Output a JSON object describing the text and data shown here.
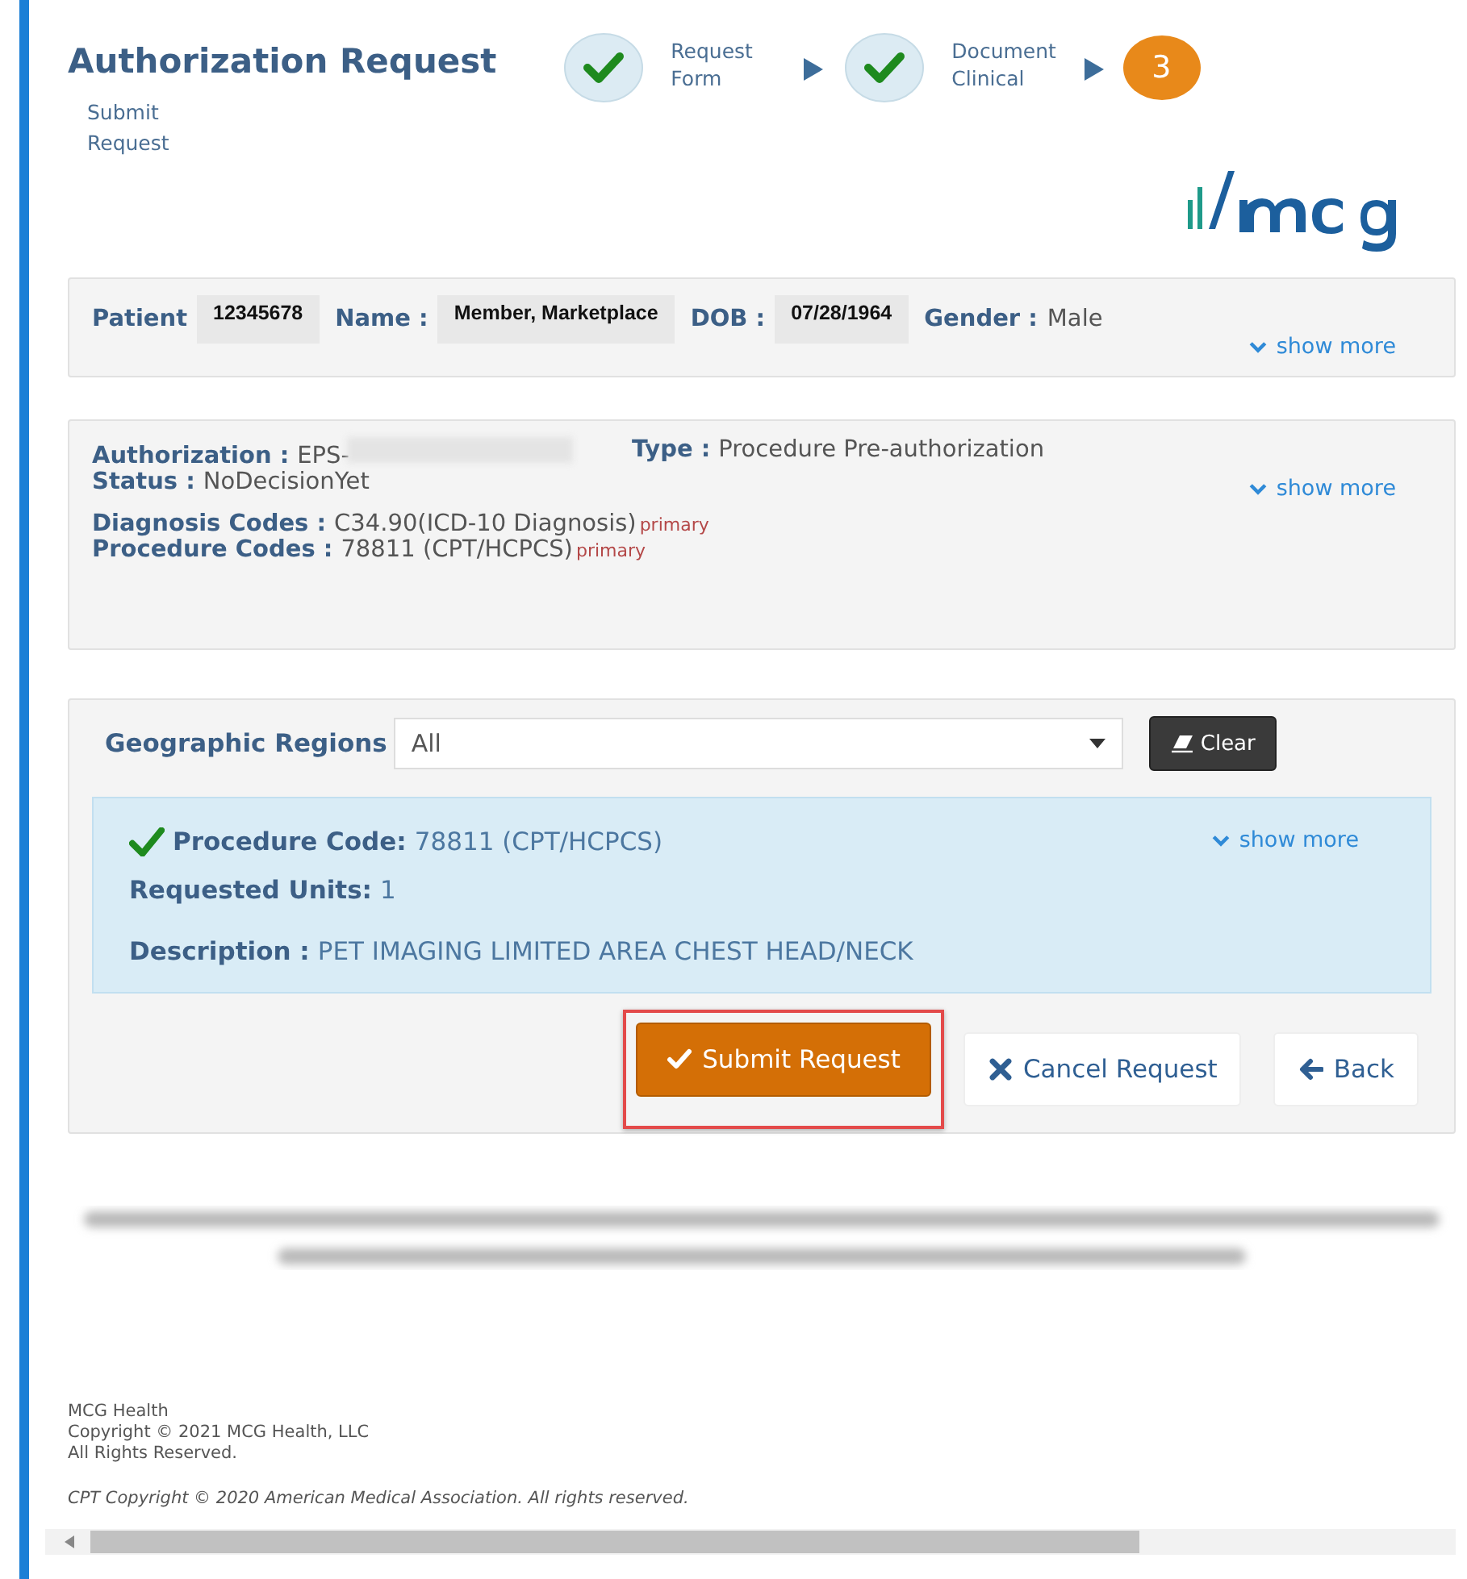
{
  "header": {
    "title": "Authorization Request",
    "current_step_label": "Submit Request",
    "steps": [
      {
        "label": "Request Form",
        "done": true
      },
      {
        "label": "Document Clinical",
        "done": true
      },
      {
        "number": "3",
        "done": false
      }
    ]
  },
  "patient": {
    "fields": [
      {
        "label": "Patient",
        "value": "12345678",
        "masked": true
      },
      {
        "label": "Name :",
        "value": "Member, Marketplace",
        "masked": true
      },
      {
        "label": "DOB :",
        "value": "07/28/1964",
        "masked": true
      },
      {
        "label": "Gender :",
        "value": "Male",
        "masked": false
      }
    ],
    "show_more": "show more"
  },
  "authorization": {
    "id_label": "Authorization :",
    "id_value": "EPS-",
    "id_redacted": true,
    "type_label": "Type :",
    "type_value": "Procedure Pre-authorization",
    "status_label": "Status :",
    "status_value": "NoDecisionYet",
    "show_more": "show more",
    "codes": [
      {
        "label": "Diagnosis Codes :",
        "value": "C34.90(ICD-10 Diagnosis)",
        "tag": "primary"
      },
      {
        "label": "Procedure Codes :",
        "value": "78811 (CPT/HCPCS)",
        "tag": "primary"
      }
    ]
  },
  "regions": {
    "label": "Geographic Regions",
    "value": "All",
    "clear": "Clear",
    "procedure": {
      "approved": true,
      "code_label": "Procedure Code:",
      "code_value": "78811 (CPT/HCPCS)",
      "show_more": "show more",
      "units_label": "Requested Units:",
      "units_value": "1",
      "description_label": "Description :",
      "description_value": "PET IMAGING LIMITED AREA CHEST HEAD/NECK"
    }
  },
  "buttons": [
    {
      "kind": "submit",
      "label": "Submit Request",
      "highlighted": true
    },
    {
      "kind": "cancel",
      "label": "Cancel Request",
      "highlighted": false
    },
    {
      "kind": "back",
      "label": "Back",
      "highlighted": false
    }
  ],
  "footer": {
    "lines": [
      "MCG Health",
      "Copyright © 2021 MCG Health, LLC",
      "All Rights Reserved."
    ],
    "cpt": "CPT Copyright © 2020 American Medical Association. All rights reserved."
  }
}
